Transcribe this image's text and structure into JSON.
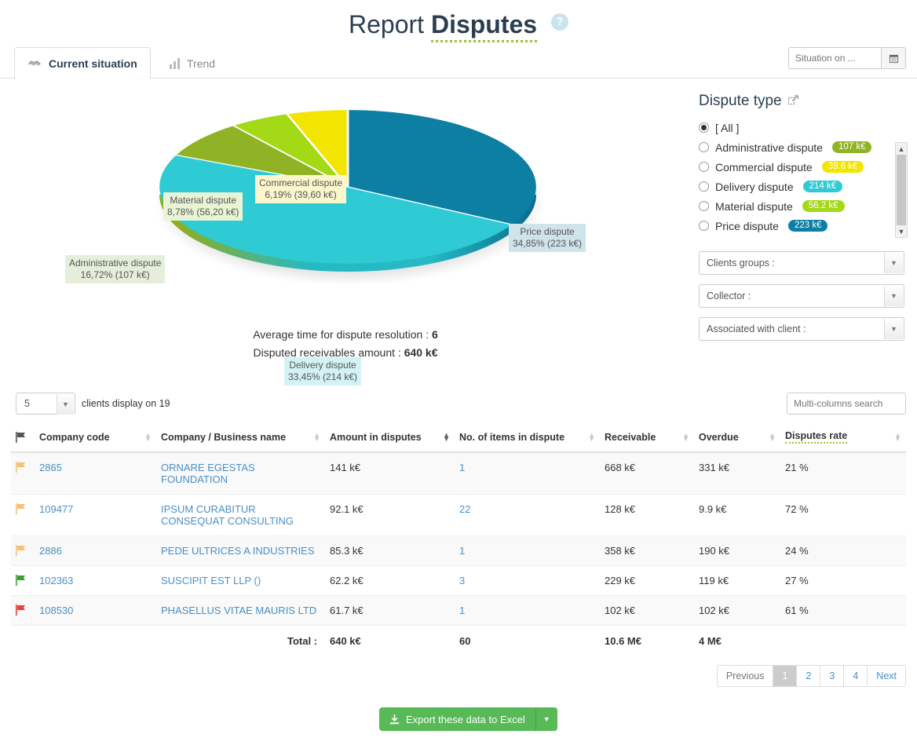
{
  "header": {
    "title_prefix": "Report",
    "title_main": "Disputes",
    "help_glyph": "?"
  },
  "tabs": [
    {
      "label": "Current situation",
      "icon": "handshake-icon",
      "active": true
    },
    {
      "label": "Trend",
      "icon": "bar-chart-icon",
      "active": false
    }
  ],
  "date_filter": {
    "placeholder": "Situation on ...",
    "value": "",
    "icon": "calendar-icon"
  },
  "chart_data": {
    "type": "pie",
    "title": "",
    "legend_position": "labels",
    "unit": "k€",
    "categories": [
      "Price dispute",
      "Delivery dispute",
      "Administrative dispute",
      "Material dispute",
      "Commercial dispute"
    ],
    "values": [
      223,
      214,
      107,
      56.2,
      39.6
    ],
    "percentages": [
      34.85,
      33.45,
      16.72,
      8.78,
      6.19
    ],
    "colors": [
      "#0c7fa3",
      "#2fcbd4",
      "#8fb324",
      "#a4d916",
      "#f2e500"
    ],
    "label_backgrounds": [
      "#cfe3ea",
      "#d3f2f5",
      "#e5eeda",
      "#e9f4d5",
      "#fbf6cc"
    ],
    "labels": [
      {
        "name": "Price dispute",
        "line2": "34,85% (223 k€)"
      },
      {
        "name": "Delivery dispute",
        "line2": "33,45% (214 k€)"
      },
      {
        "name": "Administrative dispute",
        "line2": "16,72% (107 k€)"
      },
      {
        "name": "Material dispute",
        "line2": "8,78% (56,20 k€)"
      },
      {
        "name": "Commercial dispute",
        "line2": "6,19% (39,60 k€)"
      }
    ]
  },
  "metrics": {
    "avg_label": "Average time for dispute resolution : ",
    "avg_value": "6",
    "amount_label": "Disputed receivables amount : ",
    "amount_value": "640 k€"
  },
  "filters": {
    "title": "Dispute type",
    "popout_icon": "popout-icon",
    "options": [
      {
        "label": "[ All ]",
        "badge": "",
        "badge_color": "",
        "selected": true
      },
      {
        "label": "Administrative dispute",
        "badge": "107 k€",
        "badge_color": "#8fb324",
        "selected": false
      },
      {
        "label": "Commercial dispute",
        "badge": "39.6 k€",
        "badge_color": "#f2e500",
        "selected": false
      },
      {
        "label": "Delivery dispute",
        "badge": "214 k€",
        "badge_color": "#2fcbd4",
        "selected": false
      },
      {
        "label": "Material dispute",
        "badge": "56.2 k€",
        "badge_color": "#a4d916",
        "selected": false
      },
      {
        "label": "Price dispute",
        "badge": "223 k€",
        "badge_color": "#0c7fa3",
        "selected": false
      }
    ],
    "selects": [
      {
        "label": "Clients groups :"
      },
      {
        "label": "Collector :"
      },
      {
        "label": "Associated with client :"
      }
    ]
  },
  "table_controls": {
    "page_length": "5",
    "length_note": "clients display on 19",
    "search_placeholder": "Multi-columns search"
  },
  "table": {
    "columns": [
      {
        "label": "",
        "icon": "flag-icon",
        "sort": "none"
      },
      {
        "label": "Company code",
        "sort": "both"
      },
      {
        "label": "Company / Business name",
        "sort": "both"
      },
      {
        "label": "Amount in disputes",
        "sort": "desc"
      },
      {
        "label": "No. of items in dispute",
        "sort": "both"
      },
      {
        "label": "Receivable",
        "sort": "both"
      },
      {
        "label": "Overdue",
        "sort": "both"
      },
      {
        "label": "Disputes rate",
        "sort": "both",
        "tooltip": true
      }
    ],
    "rows": [
      {
        "flag_color": "#f5c177",
        "code": "2865",
        "name": "ORNARE EGESTAS FOUNDATION",
        "amount": "141 k€",
        "items": "1",
        "receivable": "668 k€",
        "overdue": "331 k€",
        "rate": "21 %"
      },
      {
        "flag_color": "#f5c177",
        "code": "109477",
        "name": "IPSUM CURABITUR CONSEQUAT CONSULTING",
        "amount": "92.1 k€",
        "items": "22",
        "receivable": "128 k€",
        "overdue": "9.9 k€",
        "rate": "72 %"
      },
      {
        "flag_color": "#f5c177",
        "code": "2886",
        "name": "PEDE ULTRICES A INDUSTRIES",
        "amount": "85.3 k€",
        "items": "1",
        "receivable": "358 k€",
        "overdue": "190 k€",
        "rate": "24 %"
      },
      {
        "flag_color": "#3f9c35",
        "code": "102363",
        "name": "SUSCIPIT EST LLP ()",
        "amount": "62.2 k€",
        "items": "3",
        "receivable": "229 k€",
        "overdue": "119 k€",
        "rate": "27 %"
      },
      {
        "flag_color": "#e8413a",
        "code": "108530",
        "name": "PHASELLUS VITAE MAURIS LTD",
        "amount": "61.7 k€",
        "items": "1",
        "receivable": "102 k€",
        "overdue": "102 k€",
        "rate": "61 %"
      }
    ],
    "total": {
      "label": "Total :",
      "amount": "640 k€",
      "items": "60",
      "receivable": "10.6 M€",
      "overdue": "4 M€",
      "rate": ""
    }
  },
  "pagination": {
    "previous": "Previous",
    "pages": [
      "1",
      "2",
      "3",
      "4"
    ],
    "current": "1",
    "next": "Next"
  },
  "export": {
    "label": "Export these data to Excel",
    "icon": "download-icon",
    "caret": "▼",
    "color": "#58b957"
  }
}
